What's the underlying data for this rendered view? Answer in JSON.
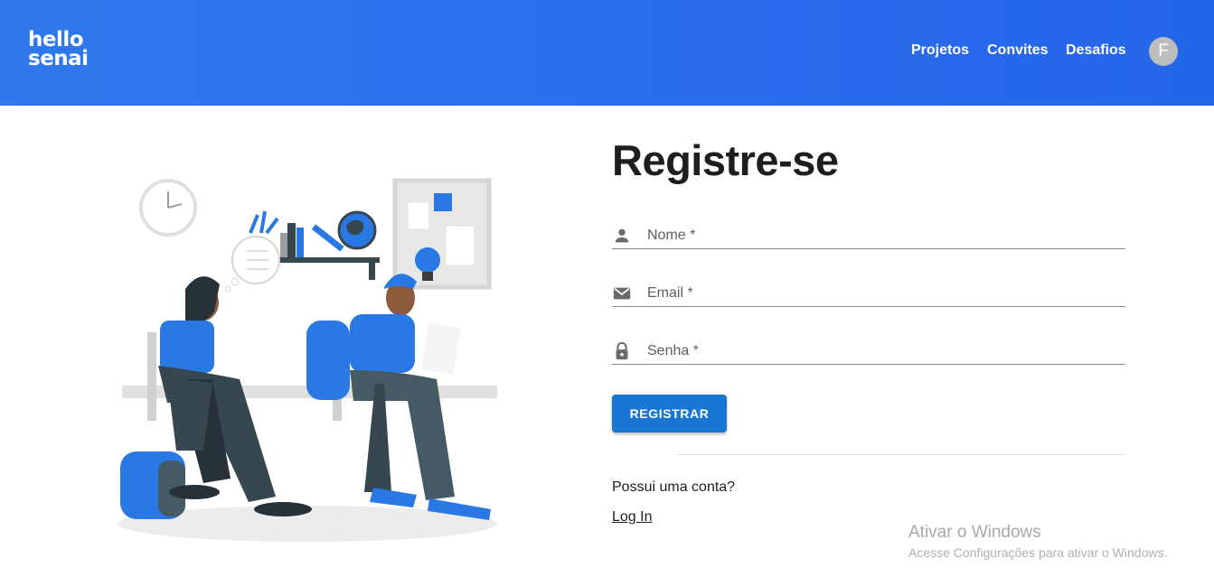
{
  "header": {
    "logo_line1": "hello",
    "logo_line2": "senai",
    "nav": [
      "Projetos",
      "Convites",
      "Desafios"
    ],
    "avatar_initial": "F"
  },
  "form": {
    "title": "Registre-se",
    "fields": [
      {
        "label": "Nome *",
        "icon": "person-icon"
      },
      {
        "label": "Email *",
        "icon": "mail-icon"
      },
      {
        "label": "Senha *",
        "icon": "lock-icon"
      }
    ],
    "submit_label": "REGISTRAR",
    "has_account_text": "Possui uma conta?",
    "login_link": "Log In"
  },
  "watermark": {
    "title": "Ativar o Windows",
    "subtitle": "Acesse Configurações para ativar o Windows."
  },
  "colors": {
    "header": "#2a6cec",
    "button": "#1976d2",
    "illustration_accent": "#2a78e4"
  }
}
